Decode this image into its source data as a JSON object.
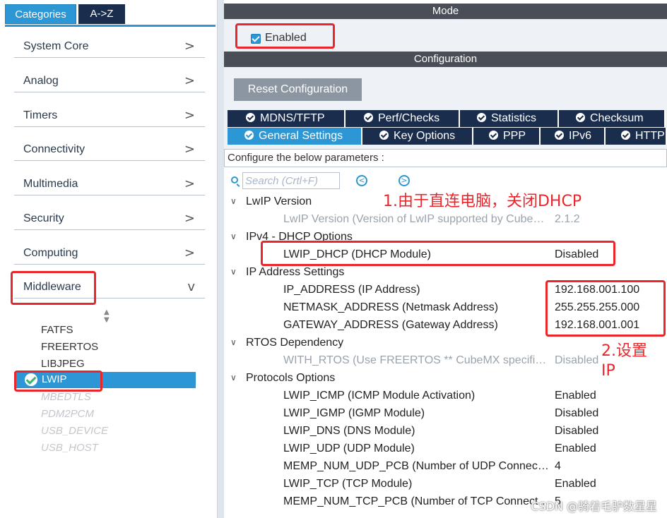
{
  "categories_tabs": {
    "categories": "Categories",
    "az": "A->Z"
  },
  "categories": [
    {
      "label": "System Core",
      "chevron": ">"
    },
    {
      "label": "Analog",
      "chevron": ">"
    },
    {
      "label": "Timers",
      "chevron": ">"
    },
    {
      "label": "Connectivity",
      "chevron": ">"
    },
    {
      "label": "Multimedia",
      "chevron": ">"
    },
    {
      "label": "Security",
      "chevron": ">"
    },
    {
      "label": "Computing",
      "chevron": ">"
    },
    {
      "label": "Middleware",
      "chevron": "v"
    }
  ],
  "middleware_items": {
    "fatfs": "FATFS",
    "freertos": "FREERTOS",
    "libjpeg": "LIBJPEG",
    "lwip": "LWIP",
    "mbedtls": "MBEDTLS",
    "pdm2pcm": "PDM2PCM",
    "usb_device": "USB_DEVICE",
    "usb_host": "USB_HOST"
  },
  "mode": {
    "title": "Mode",
    "enabled_label": "Enabled",
    "enabled_checked": true
  },
  "configuration": {
    "title": "Configuration",
    "reset_button": "Reset Configuration",
    "tabs_row1": [
      "MDNS/TFTP",
      "Perf/Checks",
      "Statistics",
      "Checksum"
    ],
    "tabs_row2": [
      "General Settings",
      "Key Options",
      "PPP",
      "IPv6",
      "HTTPD"
    ],
    "active_tab": "General Settings",
    "configure_text": "Configure the below parameters :",
    "search_placeholder": "Search (Crtl+F)"
  },
  "tree": {
    "lwip_version": {
      "title": "LwIP Version",
      "p1_name": "LwIP Version (Version of LwIP supported by Cube…",
      "p1_value": "2.1.2"
    },
    "dhcp": {
      "title": "IPv4 - DHCP Options",
      "p1_name": "LWIP_DHCP (DHCP Module)",
      "p1_value": "Disabled"
    },
    "ip": {
      "title": "IP Address Settings",
      "p1_name": "IP_ADDRESS (IP Address)",
      "p1_value": "192.168.001.100",
      "p2_name": "NETMASK_ADDRESS (Netmask Address)",
      "p2_value": "255.255.255.000",
      "p3_name": "GATEWAY_ADDRESS (Gateway Address)",
      "p3_value": "192.168.001.001"
    },
    "rtos": {
      "title": "RTOS Dependency",
      "p1_name": "WITH_RTOS (Use FREERTOS ** CubeMX specifi…",
      "p1_value": "Disabled"
    },
    "protocols": {
      "title": "Protocols Options",
      "p1_name": "LWIP_ICMP (ICMP Module Activation)",
      "p1_value": "Enabled",
      "p2_name": "LWIP_IGMP (IGMP Module)",
      "p2_value": "Disabled",
      "p3_name": "LWIP_DNS (DNS Module)",
      "p3_value": "Disabled",
      "p4_name": "LWIP_UDP (UDP Module)",
      "p4_value": "Enabled",
      "p5_name": "MEMP_NUM_UDP_PCB (Number of UDP Connec…",
      "p5_value": "4",
      "p6_name": "LWIP_TCP (TCP Module)",
      "p6_value": "Enabled",
      "p7_name": "MEMP_NUM_TCP_PCB (Number of TCP Connect…",
      "p7_value": "5"
    }
  },
  "annotations": {
    "note1": "1.由于直连电脑，关闭DHCP",
    "note2_line1": "2.设置",
    "note2_line2": "IP",
    "color": "#e8262b"
  },
  "watermark": "CSDN @骑着毛驴数星星",
  "colors": {
    "accent": "#2c97d4",
    "navy": "#1a2d4d",
    "bar": "#4a4f57"
  }
}
